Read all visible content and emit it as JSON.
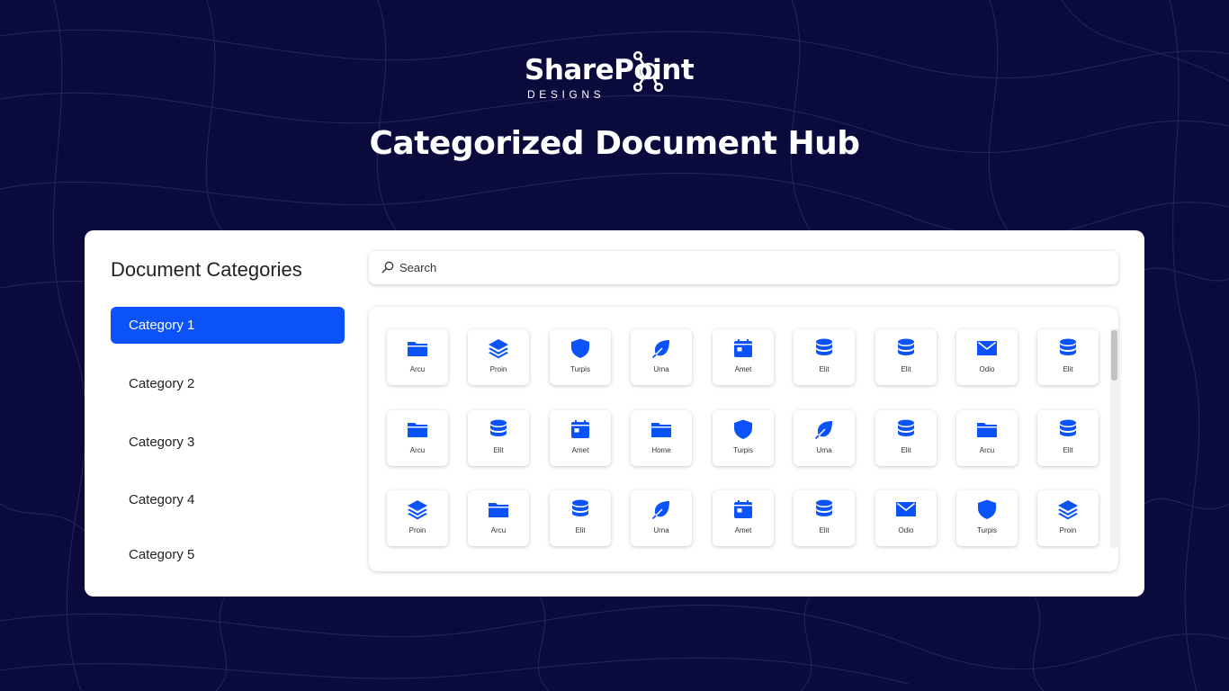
{
  "brand": {
    "logo_text": "SharePoint",
    "logo_sub": "DESIGNS",
    "hero_title": "Categorized Document Hub"
  },
  "sidebar": {
    "title": "Document Categories",
    "items": [
      {
        "label": "Category 1",
        "active": true
      },
      {
        "label": "Category 2",
        "active": false
      },
      {
        "label": "Category 3",
        "active": false
      },
      {
        "label": "Category 4",
        "active": false
      },
      {
        "label": "Category 5",
        "active": false
      }
    ]
  },
  "search": {
    "placeholder": "Search"
  },
  "tiles": [
    [
      {
        "label": "Arcu",
        "icon": "folder"
      },
      {
        "label": "Proin",
        "icon": "layers"
      },
      {
        "label": "Turpis",
        "icon": "shield"
      },
      {
        "label": "Urna",
        "icon": "leaf"
      },
      {
        "label": "Amet",
        "icon": "calendar"
      },
      {
        "label": "Elit",
        "icon": "database"
      },
      {
        "label": "Elit",
        "icon": "database"
      },
      {
        "label": "Odio",
        "icon": "mail"
      },
      {
        "label": "Elit",
        "icon": "database"
      }
    ],
    [
      {
        "label": "Arcu",
        "icon": "folder"
      },
      {
        "label": "Elit",
        "icon": "database"
      },
      {
        "label": "Amet",
        "icon": "calendar"
      },
      {
        "label": "Home",
        "icon": "folder"
      },
      {
        "label": "Turpis",
        "icon": "shield"
      },
      {
        "label": "Urna",
        "icon": "leaf"
      },
      {
        "label": "Elit",
        "icon": "database"
      },
      {
        "label": "Arcu",
        "icon": "folder"
      },
      {
        "label": "Elit",
        "icon": "database"
      }
    ],
    [
      {
        "label": "Proin",
        "icon": "layers"
      },
      {
        "label": "Arcu",
        "icon": "folder"
      },
      {
        "label": "Elit",
        "icon": "database"
      },
      {
        "label": "Urna",
        "icon": "leaf"
      },
      {
        "label": "Amet",
        "icon": "calendar"
      },
      {
        "label": "Elit",
        "icon": "database"
      },
      {
        "label": "Odio",
        "icon": "mail"
      },
      {
        "label": "Turpis",
        "icon": "shield"
      },
      {
        "label": "Proin",
        "icon": "layers"
      }
    ]
  ],
  "colors": {
    "background": "#0b0a3d",
    "accent": "#0b52f9",
    "icon": "#0b52f9",
    "panel": "#ffffff"
  }
}
